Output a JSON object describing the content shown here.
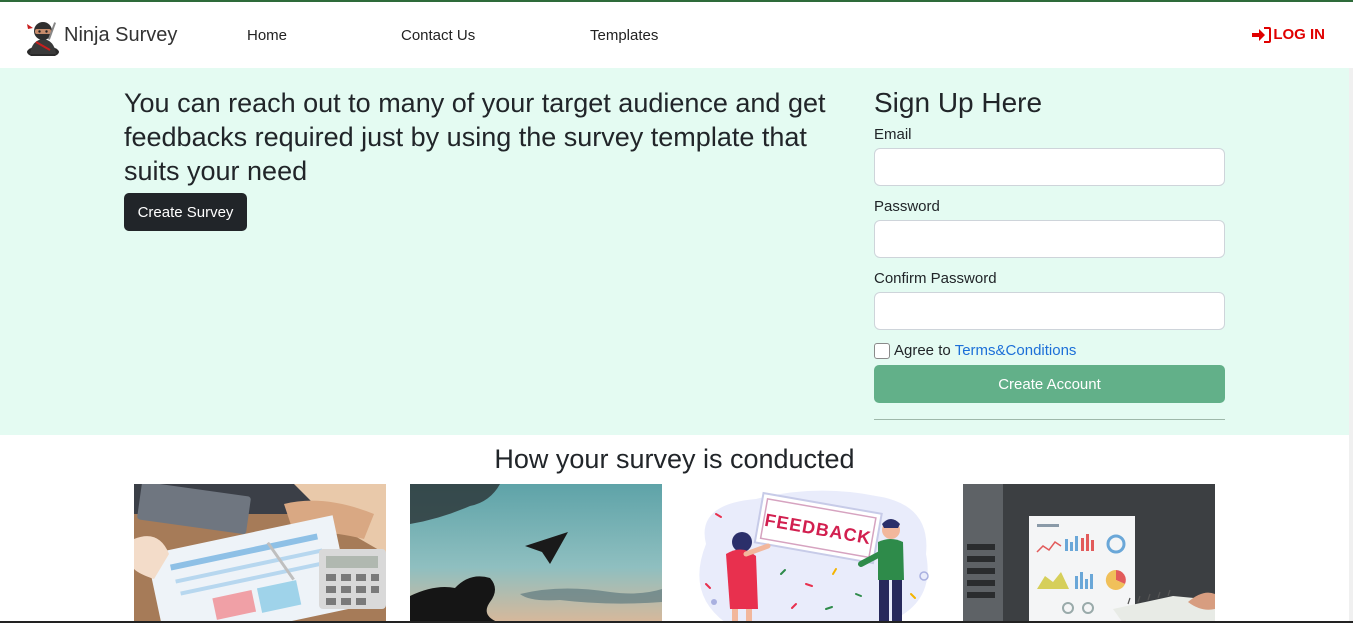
{
  "nav": {
    "brand": "Ninja Survey",
    "links": [
      "Home",
      "Contact Us",
      "Templates"
    ],
    "login": "LOG IN"
  },
  "hero": {
    "heading": "You can reach out to many of your target audience and get feedbacks required just by using the survey template that suits your need",
    "create_survey": "Create Survey"
  },
  "signup": {
    "title": "Sign Up Here",
    "email_label": "Email",
    "password_label": "Password",
    "confirm_label": "Confirm Password",
    "agree_text": "Agree to",
    "terms_link": "Terms&Conditions",
    "submit": "Create Account"
  },
  "section": {
    "title": "How your survey is conducted"
  },
  "cards": [
    {
      "image": "paperwork-calculator-photo"
    },
    {
      "image": "paper-plane-sky-photo"
    },
    {
      "image": "feedback-illustration",
      "text": "FEEDBACK"
    },
    {
      "image": "analytics-charts-photo"
    }
  ],
  "colors": {
    "hero_bg": "#e4fbf2",
    "login": "#e00000",
    "primary_dark": "#212529",
    "accent_green": "#62b089",
    "link": "#1c6fd8"
  }
}
